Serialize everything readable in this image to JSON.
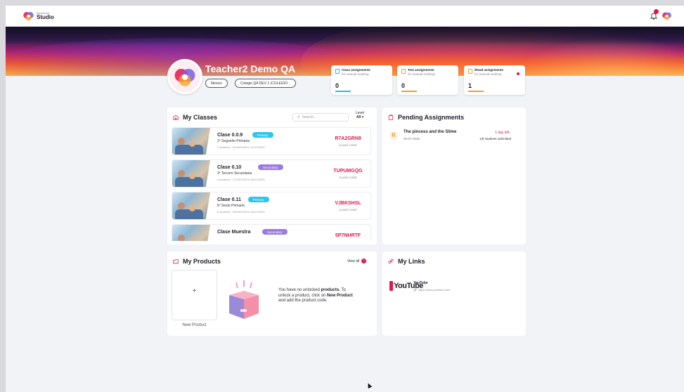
{
  "app": {
    "brand": "Richmond",
    "name": "Studio"
  },
  "teacher": {
    "name": "Teacher2 Demo QA",
    "country": "Mexico",
    "school": "Colegio QA DEV 1 (COLEGIO..."
  },
  "stats": [
    {
      "title": "Class assignments",
      "subtitle": "for manual marking",
      "value": "0",
      "color": "#2bb5e8"
    },
    {
      "title": "Test assignments",
      "subtitle": "for manual marking",
      "value": "0",
      "color": "#e8a02b"
    },
    {
      "title": "iRead assignments",
      "subtitle": "for manual marking",
      "value": "1",
      "color": "#e8a02b"
    }
  ],
  "classes": {
    "title": "My Classes",
    "search_placeholder": "Search...",
    "level_label": "Level",
    "level_value": "All",
    "items": [
      {
        "name": "Clase 0.0.9",
        "badge": "Primary",
        "badge_color": "#2bc6ea",
        "grade": "2º Segundo Primaria",
        "meta": "2 students · 02/04/2025 to 31/12/2025",
        "code": "R7A2GRN9",
        "code_label": "CLASS CODE"
      },
      {
        "name": "Clase 0.10",
        "badge": "Secondary",
        "badge_color": "#9b7be0",
        "grade": "3º Tercero Secundaria",
        "meta": "4 students · 27/04/2025 to 29/12/2025",
        "code": "TUPUMGQG",
        "code_label": "CLASS CODE"
      },
      {
        "name": "Clase 0.11",
        "badge": "Primary",
        "badge_color": "#2bc6ea",
        "grade": "6º Sexto Primaria",
        "meta": "8 students · 03/03/2025 to 29/12/2025",
        "code": "VJBKSHSL",
        "code_label": "CLASS CODE"
      },
      {
        "name": "Clase Muestra",
        "badge": "Secondary",
        "badge_color": "#9b7be0",
        "grade": "",
        "meta": "",
        "code": "5P7NHRTF",
        "code_label": ""
      }
    ]
  },
  "pending": {
    "title": "Pending Assignments",
    "item": {
      "title": "The pincess and the Slime",
      "date": "05-07-2025",
      "due": "1 day left",
      "submitted": "1/8 students submitted"
    }
  },
  "products": {
    "title": "My Products",
    "view_all": "View all",
    "new_product": "New Product",
    "msg_part1": "You have no unlocked ",
    "msg_bold1": "products.",
    "msg_part2": " To unlock a product, click on ",
    "msg_bold2": "New Product",
    "msg_part3": " and add the product code."
  },
  "links": {
    "title": "My Links",
    "items": [
      {
        "logo_text": "YouTube",
        "title": "YouTube",
        "url": "https://www.youtube.com/"
      }
    ]
  },
  "colors": {
    "accent": "#e6154a",
    "primary_badge": "#2bc6ea",
    "secondary_badge": "#9b7be0",
    "warn": "#e8a02b"
  }
}
